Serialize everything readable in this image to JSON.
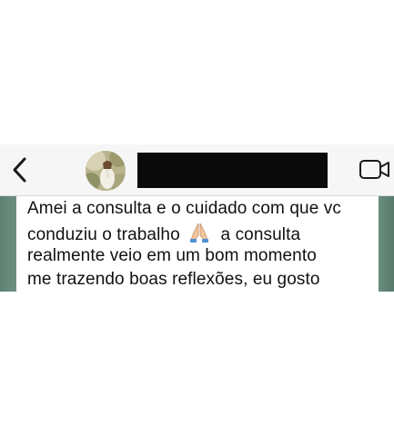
{
  "header": {
    "back_icon": "chevron-left-icon",
    "avatar_icon": "contact-avatar-photo",
    "contact_name": "",
    "video_icon": "video-camera-icon"
  },
  "message": {
    "line1": "Amei a consulta e o cuidado com que vc",
    "line2_before": "conduziu o trabalho",
    "line2_emoji": "🙏",
    "line2_after": "a consulta",
    "line3": "realmente veio em um bom momento",
    "line4": "me trazendo boas reflexões, eu gosto"
  },
  "colors": {
    "header_bg": "#f6f6f6",
    "redaction": "#0a0a0a",
    "bubble_bg": "#ffffff",
    "text": "#111111",
    "wallpaper": "#8fa99b"
  }
}
